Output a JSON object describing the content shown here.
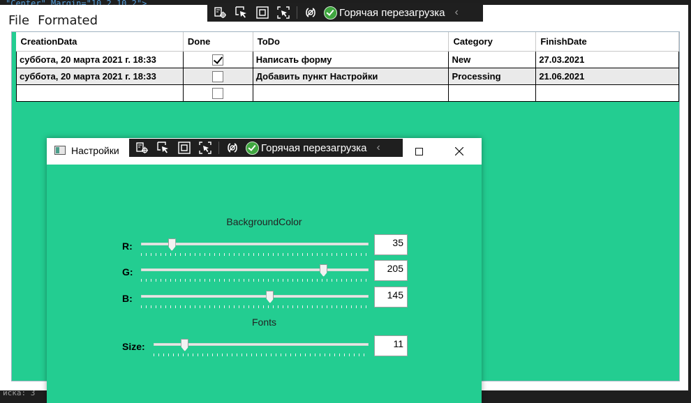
{
  "background": {
    "code_snippet": "\"Center\" Margin=\"10,2,10,2\">",
    "status_text": "иска: 3"
  },
  "main_window": {
    "menu": [
      "File",
      "Formated"
    ],
    "grid": {
      "headers": [
        "CreationData",
        "Done",
        "ToDo",
        "Category",
        "FinishDate"
      ],
      "rows": [
        {
          "creation": "суббота, 20 марта 2021 г. 18:33",
          "done": true,
          "todo": "Написать форму",
          "category": "New",
          "finish": "27.03.2021"
        },
        {
          "creation": "суббота, 20 марта 2021 г. 18:33",
          "done": false,
          "todo": "Добавить пункт Настройки",
          "category": "Processing",
          "finish": "21.06.2021"
        },
        {
          "creation": "",
          "done": false,
          "todo": "",
          "category": "",
          "finish": ""
        }
      ]
    },
    "background_color": "#23cd91"
  },
  "dev_toolbar": {
    "hot_reload_label": "Горячая перезагрузка",
    "icons": [
      "live-visual-tree-icon",
      "select-element-icon",
      "display-layout-adorners-icon",
      "track-focus-icon",
      "binding-failures-icon",
      "hot-reload-status-icon",
      "collapse-chevron-icon"
    ]
  },
  "settings_window": {
    "title": "Настройки",
    "background_color_section": "BackgroundColor",
    "fonts_section": "Fonts",
    "sliders": {
      "r": {
        "label": "R:",
        "value": "35",
        "max": 255
      },
      "g": {
        "label": "G:",
        "value": "205",
        "max": 255
      },
      "b": {
        "label": "B:",
        "value": "145",
        "max": 255
      },
      "size": {
        "label": "Size:",
        "value": "11",
        "min": 6,
        "max": 40
      }
    }
  },
  "colors": {
    "accent_green": "#23cd91",
    "toolbar_dark": "#1f1f1f",
    "hot_reload_ok": "#3fa63f"
  }
}
